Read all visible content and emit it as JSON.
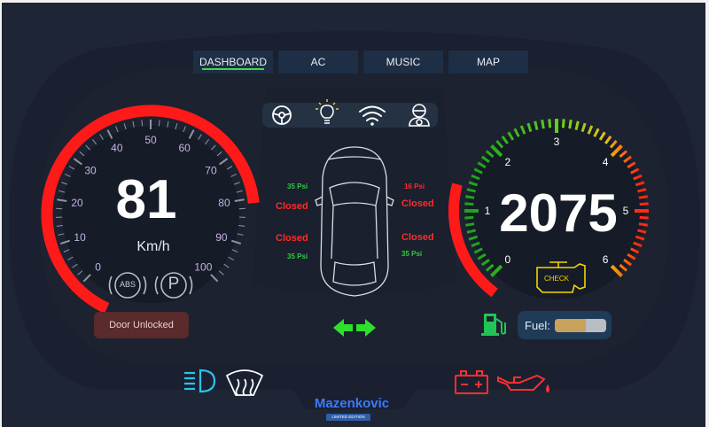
{
  "tabs": [
    {
      "label": "DASHBOARD",
      "active": true
    },
    {
      "label": "AC",
      "active": false
    },
    {
      "label": "MUSIC",
      "active": false
    },
    {
      "label": "MAP",
      "active": false
    }
  ],
  "speedometer": {
    "speed": "81",
    "unit": "Km/h",
    "ticks": [
      "0",
      "10",
      "20",
      "30",
      "40",
      "50",
      "60",
      "70",
      "80",
      "90",
      "100"
    ],
    "max": 100
  },
  "tachometer": {
    "rpm": "2075",
    "ticks": [
      "0",
      "1",
      "2",
      "3",
      "4",
      "5",
      "6"
    ],
    "max_x1000": 6
  },
  "indicators": {
    "abs_label": "ABS",
    "parking_label": "P",
    "check_label": "CHECK",
    "door_status": "Door Unlocked"
  },
  "tires": {
    "front_left": {
      "pressure": "35 Psi",
      "door": "Closed"
    },
    "front_right": {
      "pressure": "16 Psi",
      "door": "Closed"
    },
    "rear_left": {
      "pressure": "35 Psi",
      "door": "Closed"
    },
    "rear_right": {
      "pressure": "35 Psi",
      "door": "Closed"
    }
  },
  "fuel": {
    "label": "Fuel:",
    "level": 0.6
  },
  "brand": {
    "name": "Mazenkovic",
    "edition": "LIMITED EDITION"
  },
  "colors": {
    "background": "#1e2534",
    "panel": "#151b27",
    "speed_arc": "#ff1a1a",
    "ok_green": "#2ecc40",
    "warning_red": "#ff2a2a",
    "accent_cyan": "#29c4e8",
    "check_yellow": "#f5d400"
  }
}
